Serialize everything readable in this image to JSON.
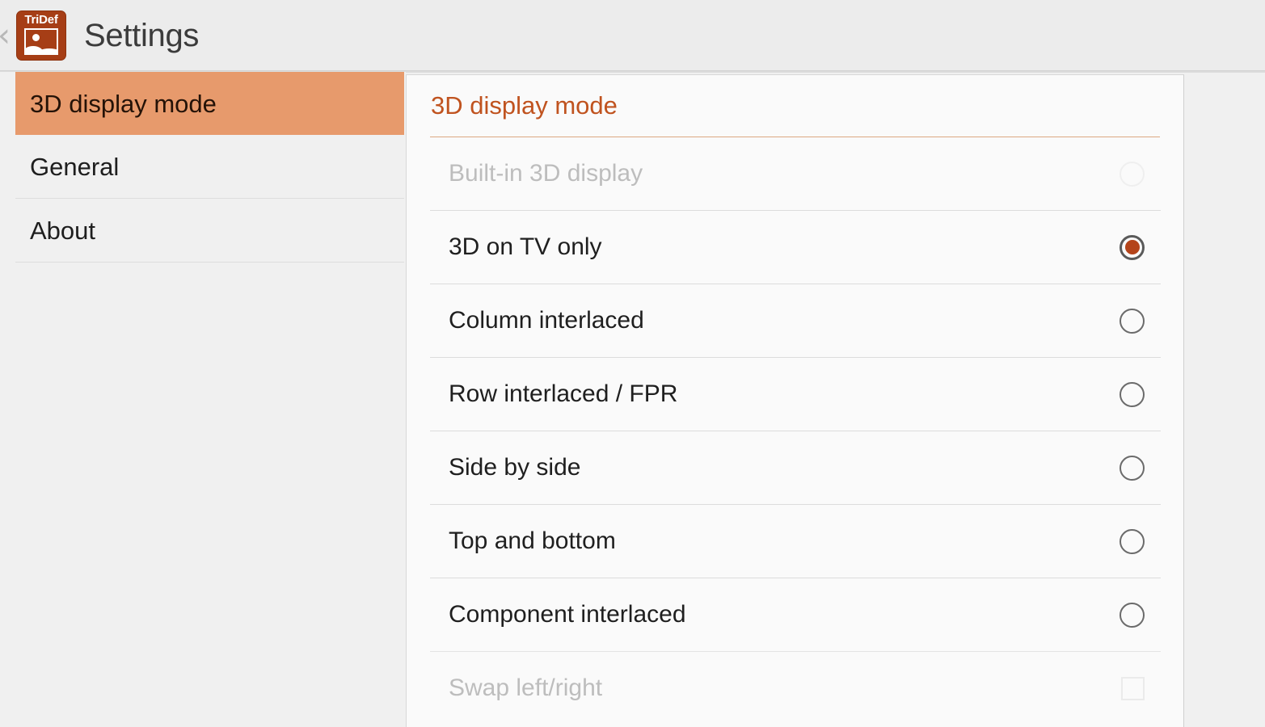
{
  "window": {
    "title": "Settings",
    "back_icon": "back-chevron-icon",
    "app_icon": {
      "name": "tridef-app-icon",
      "brand": "TriDef"
    }
  },
  "sidebar": {
    "items": [
      {
        "label": "3D display mode",
        "selected": true
      },
      {
        "label": "General",
        "selected": false
      },
      {
        "label": "About",
        "selected": false
      }
    ]
  },
  "panel": {
    "header": "3D display mode",
    "options": [
      {
        "label": "Built-in 3D display",
        "control": "radio",
        "checked": false,
        "disabled": true
      },
      {
        "label": "3D on TV only",
        "control": "radio",
        "checked": true,
        "disabled": false
      },
      {
        "label": "Column interlaced",
        "control": "radio",
        "checked": false,
        "disabled": false
      },
      {
        "label": "Row interlaced / FPR",
        "control": "radio",
        "checked": false,
        "disabled": false
      },
      {
        "label": "Side by side",
        "control": "radio",
        "checked": false,
        "disabled": false
      },
      {
        "label": "Top and bottom",
        "control": "radio",
        "checked": false,
        "disabled": false
      },
      {
        "label": "Component interlaced",
        "control": "radio",
        "checked": false,
        "disabled": false
      },
      {
        "label": "Swap left/right",
        "control": "checkbox",
        "checked": false,
        "disabled": true
      }
    ]
  },
  "colors": {
    "accent": "#c0531f",
    "selected_row": "#e79a6c",
    "radio_fill": "#b4441a",
    "app_icon_bg": "#a63e16",
    "page_bg": "#f0f0f0"
  }
}
